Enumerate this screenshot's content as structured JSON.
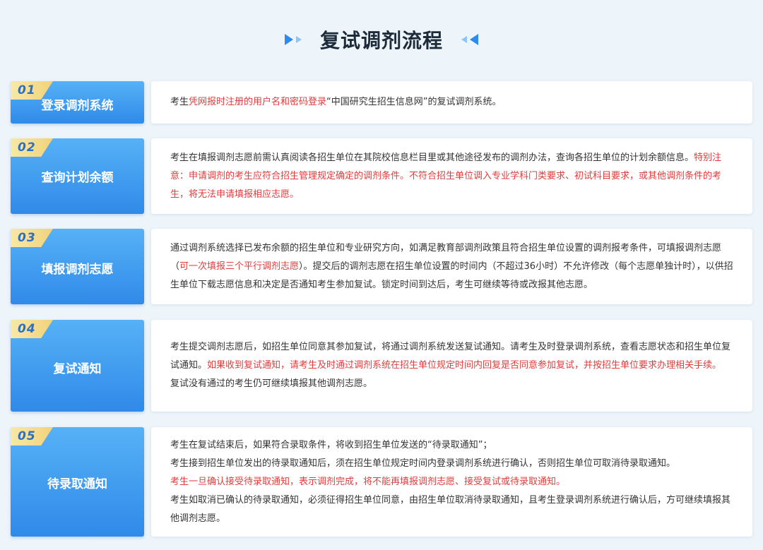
{
  "title": "复试调剂流程",
  "colors": {
    "accent_blue": "#2f8ae9",
    "badge_yellow": "#f1d27a",
    "highlight_red": "#e03c3c",
    "text": "#333333"
  },
  "steps": [
    {
      "number": "01",
      "label": "登录调剂系统",
      "lines": [
        [
          {
            "text": "考生",
            "red": false
          },
          {
            "text": "凭网报时注册的用户名和密码登录",
            "red": true
          },
          {
            "text": "“中国研究生招生信息网”的复试调剂系统。",
            "red": false
          }
        ]
      ]
    },
    {
      "number": "02",
      "label": "查询计划余额",
      "lines": [
        [
          {
            "text": "考生在填报调剂志愿前需认真阅读各招生单位在其院校信息栏目里或其他途径发布的调剂办法，查询各招生单位的计划余额信息。",
            "red": false
          },
          {
            "text": "特别注意：申请调剂的考生应符合招生管理规定确定的调剂条件。不符合招生单位调入专业学科门类要求、初试科目要求，或其他调剂条件的考生，将无法申请填报相应志愿。",
            "red": true
          }
        ]
      ]
    },
    {
      "number": "03",
      "label": "填报调剂志愿",
      "lines": [
        [
          {
            "text": "通过调剂系统选择已发布余额的招生单位和专业研究方向，如满足教育部调剂政策且符合招生单位设置的调剂报考条件，可填报调剂志愿（",
            "red": false
          },
          {
            "text": "可一次填报三个平行调剂志愿",
            "red": true
          },
          {
            "text": "）。提交后的调剂志愿在招生单位设置的时间内（不超过36小时）不允许修改（每个志愿单独计时），以供招生单位下载志愿信息和决定是否通知考生参加复试。锁定时间到达后，考生可继续等待或改报其他志愿。",
            "red": false
          }
        ]
      ]
    },
    {
      "number": "04",
      "label": "复试通知",
      "lines": [
        [
          {
            "text": "考生提交调剂志愿后，如招生单位同意其参加复试，将通过调剂系统发送复试通知。请考生及时登录调剂系统，查看志愿状态和招生单位复试通知。",
            "red": false
          },
          {
            "text": "如果收到复试通知，请考生及时通过调剂系统在招生单位规定时间内回复是否同意参加复试，并按招生单位要求办理相关手续。",
            "red": true
          }
        ],
        [
          {
            "text": "复试没有通过的考生仍可继续填报其他调剂志愿。",
            "red": false
          }
        ]
      ]
    },
    {
      "number": "05",
      "label": "待录取通知",
      "lines": [
        [
          {
            "text": "考生在复试结束后，如果符合录取条件，将收到招生单位发送的“待录取通知”；",
            "red": false
          }
        ],
        [
          {
            "text": "考生接到招生单位发出的待录取通知后，须在招生单位规定时间内登录调剂系统进行确认，否则招生单位可取消待录取通知。",
            "red": false
          }
        ],
        [
          {
            "text": "考生一旦确认接受待录取通知，表示调剂完成，将不能再填报调剂志愿、接受复试或待录取通知。",
            "red": true
          }
        ],
        [
          {
            "text": "考生如取消已确认的待录取通知，必须征得招生单位同意，由招生单位取消待录取通知，且考生登录调剂系统进行确认后，方可继续填报其他调剂志愿。",
            "red": false
          }
        ]
      ]
    }
  ]
}
